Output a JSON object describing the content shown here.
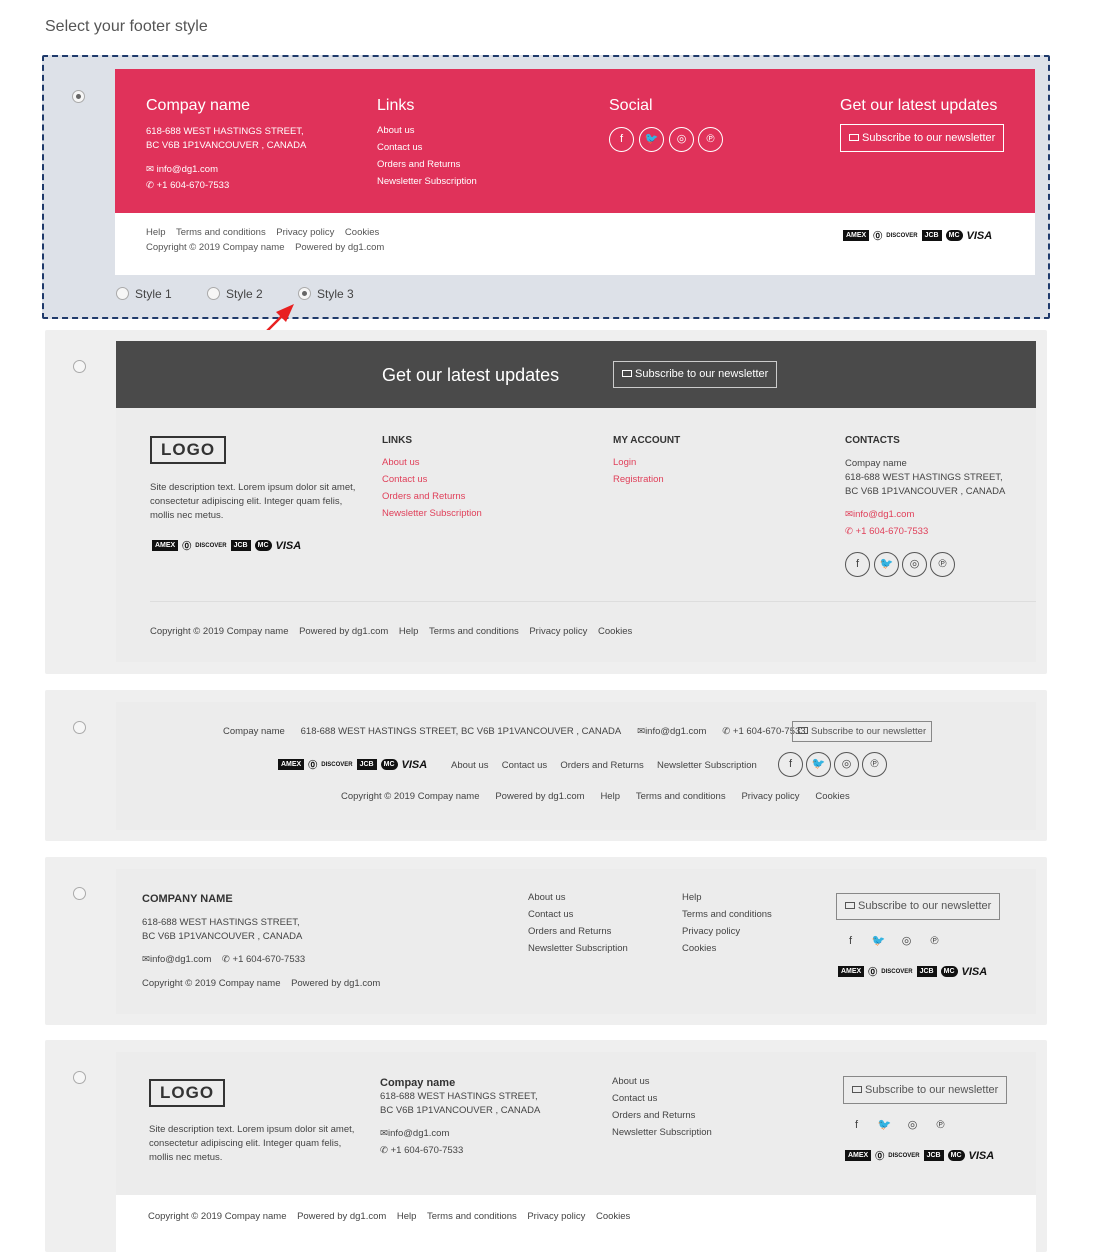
{
  "page_title": "Select your footer style",
  "common": {
    "company_name": "Compay name",
    "company_name_upper": "COMPANY NAME",
    "address_line1": "618-688 WEST HASTINGS STREET,",
    "address_line2": "BC V6B 1P1VANCOUVER , CANADA",
    "address_full": "618-688 WEST HASTINGS STREET, BC V6B 1P1VANCOUVER , CANADA",
    "email": "info@dg1.com",
    "phone": "+1 604-670-7533",
    "links": [
      "About us",
      "Contact us",
      "Orders and Returns",
      "Newsletter Subscription"
    ],
    "legal": [
      "Help",
      "Terms and conditions",
      "Privacy policy",
      "Cookies"
    ],
    "copyright": "Copyright © 2019 Compay name",
    "powered": "Powered by dg1.com",
    "subscribe": "Subscribe to our newsletter",
    "logo": "LOGO",
    "description": [
      "Site description text. Lorem ipsum dolor sit amet,",
      "consectetur adipiscing elit. Integer quam felis,",
      "mollis nec metus."
    ],
    "payments": [
      "AMEX",
      "Diners",
      "DISCOVER",
      "JCB",
      "MasterCard",
      "VISA"
    ],
    "social_icons": [
      "facebook-icon",
      "twitter-icon",
      "instagram-icon",
      "pinterest-icon"
    ]
  },
  "option1": {
    "links_heading": "Links",
    "social_heading": "Social",
    "updates_heading": "Get our latest updates",
    "styles": [
      "Style 1",
      "Style 2",
      "Style 3"
    ],
    "accent": "#e0325a"
  },
  "option2": {
    "updates_heading": "Get our latest updates",
    "links_heading": "LINKS",
    "account_heading": "MY ACCOUNT",
    "account_links": [
      "Login",
      "Registration"
    ],
    "contacts_heading": "CONTACTS",
    "banner_color": "#4a4a4a"
  },
  "option5": {
    "company_bold": "Compay name"
  }
}
